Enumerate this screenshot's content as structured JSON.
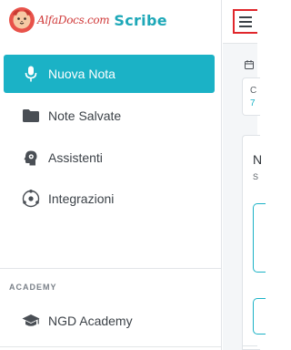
{
  "brand": {
    "logo_word": "AlfaDocs.com",
    "product": "Scribe",
    "colors": {
      "logo_red": "#d03a3a",
      "product_teal": "#1ea8b8"
    }
  },
  "sidebar": {
    "items": [
      {
        "label": "Nuova Nota",
        "icon": "microphone-icon",
        "active": true
      },
      {
        "label": "Note Salvate",
        "icon": "folder-icon",
        "active": false
      },
      {
        "label": "Assistenti",
        "icon": "head-gear-icon",
        "active": false
      },
      {
        "label": "Integrazioni",
        "icon": "orbit-icon",
        "active": false
      }
    ],
    "sections": [
      {
        "label": "ACADEMY",
        "items": [
          {
            "label": "NGD Academy",
            "icon": "graduation-cap-icon",
            "active": false
          }
        ]
      }
    ]
  },
  "topbar": {
    "menu_icon": "hamburger-menu-icon",
    "highlight_color": "#e0262b"
  },
  "main": {
    "calendar_icon": "calendar-icon",
    "card_top": {
      "line1": "C",
      "line2": "7"
    },
    "card_main": {
      "heading": "N",
      "subheading": "S"
    }
  },
  "colors": {
    "accent": "#1bb2c6",
    "text": "#3c4248",
    "border": "#e2e5e8"
  }
}
